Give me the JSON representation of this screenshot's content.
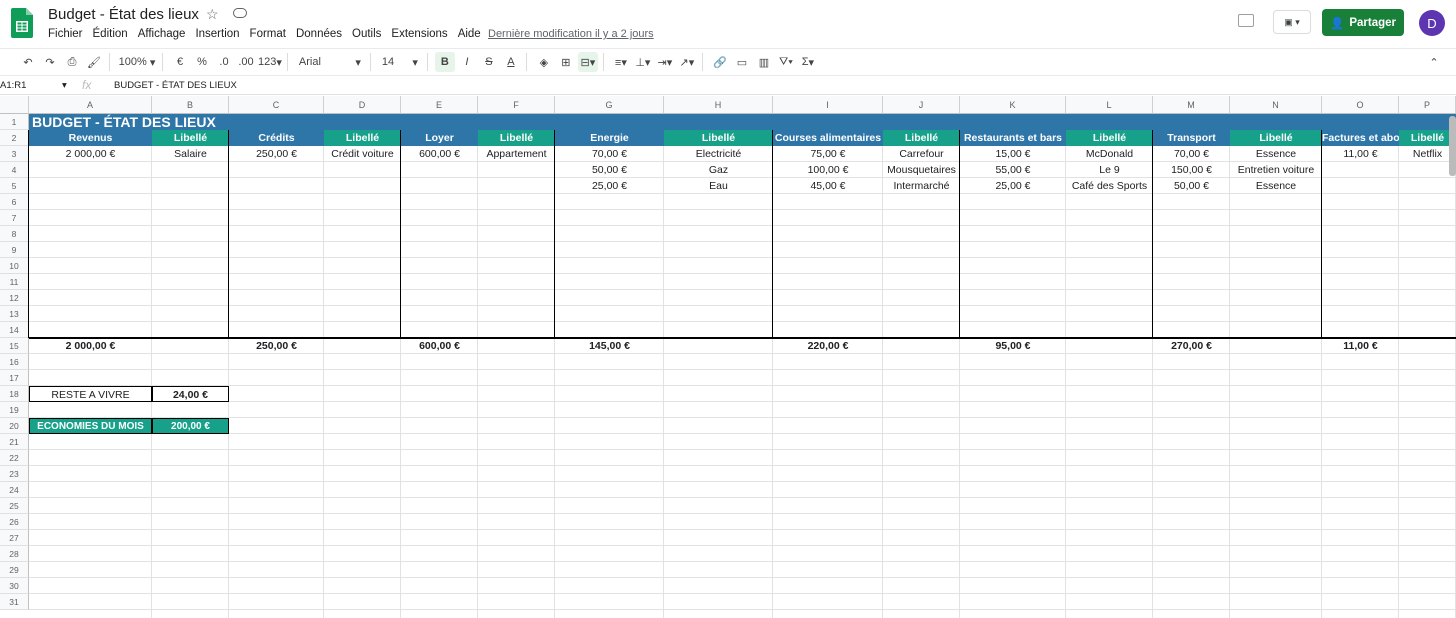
{
  "app": {
    "title": "Budget - État des lieux",
    "menus": [
      "Fichier",
      "Édition",
      "Affichage",
      "Insertion",
      "Format",
      "Données",
      "Outils",
      "Extensions",
      "Aide"
    ],
    "last_modified": "Dernière modification il y a 2 jours",
    "share_label": "Partager",
    "avatar_letter": "D"
  },
  "toolbar": {
    "zoom": "100%",
    "currency": "€",
    "percent": "%",
    "dec_minus": ".0",
    "dec_plus": ".00",
    "format_more": "123",
    "font": "Arial",
    "font_size": "14",
    "bold": "B",
    "italic": "I",
    "strike": "S",
    "text_color": "A",
    "sigma": "Σ"
  },
  "formula_bar": {
    "name_box": "A1:R1",
    "fx": "fx",
    "formula": "BUDGET - ÉTAT DES LIEUX"
  },
  "columns": [
    "A",
    "B",
    "C",
    "D",
    "E",
    "F",
    "G",
    "H",
    "I",
    "J",
    "K",
    "L",
    "M",
    "N",
    "O",
    "P"
  ],
  "rows": [
    "1",
    "2",
    "3",
    "4",
    "5",
    "6",
    "7",
    "8",
    "9",
    "10",
    "11",
    "12",
    "13",
    "14",
    "15",
    "16",
    "17",
    "18",
    "19",
    "20",
    "21",
    "22",
    "23",
    "24",
    "25",
    "26",
    "27",
    "28",
    "29",
    "30",
    "31"
  ],
  "sheet": {
    "title": "BUDGET - ÉTAT DES LIEUX",
    "headers": [
      "Revenus",
      "Libellé",
      "Crédits",
      "Libellé",
      "Loyer",
      "Libellé",
      "Energie",
      "Libellé",
      "Courses alimentaires",
      "Libellé",
      "Restaurants et bars",
      "Libellé",
      "Transport",
      "Libellé",
      "Factures et abo",
      "Libellé"
    ],
    "row3": [
      "2 000,00 €",
      "Salaire",
      "250,00 €",
      "Crédit voiture",
      "600,00 €",
      "Appartement",
      "70,00 €",
      "Electricité",
      "75,00 €",
      "Carrefour",
      "15,00 €",
      "McDonald",
      "70,00 €",
      "Essence",
      "11,00 €",
      "Netflix"
    ],
    "row4": [
      "",
      "",
      "",
      "",
      "",
      "",
      "50,00 €",
      "Gaz",
      "100,00 €",
      "Mousquetaires",
      "55,00 €",
      "Le 9",
      "150,00 €",
      "Entretien voiture",
      "",
      ""
    ],
    "row5": [
      "",
      "",
      "",
      "",
      "",
      "",
      "25,00 €",
      "Eau",
      "45,00 €",
      "Intermarché",
      "25,00 €",
      "Café des Sports",
      "50,00 €",
      "Essence",
      "",
      ""
    ],
    "totals": [
      "2 000,00 €",
      "",
      "250,00 €",
      "",
      "600,00 €",
      "",
      "145,00 €",
      "",
      "220,00 €",
      "",
      "95,00 €",
      "",
      "270,00 €",
      "",
      "11,00 €",
      ""
    ],
    "reste_label": "RESTE A VIVRE",
    "reste_value": "24,00 €",
    "eco_label": "ECONOMIES DU MOIS",
    "eco_value": "200,00 €"
  },
  "colors": {
    "header_blue": "#2e75a8",
    "header_teal": "#17a08a",
    "share_green": "#188038",
    "avatar": "#5e35b1"
  }
}
